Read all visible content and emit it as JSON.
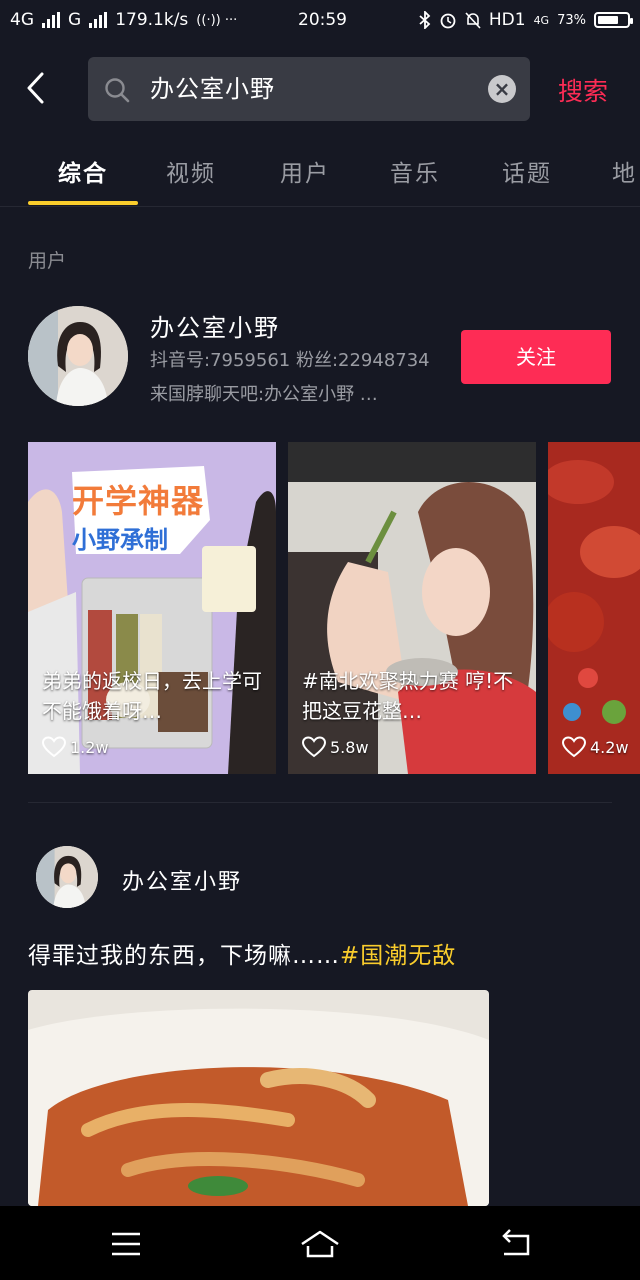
{
  "status_bar": {
    "net1": "4G",
    "net2": "G",
    "speed": "179.1k/s",
    "extra": "((·)) ···",
    "time": "20:59",
    "hd": "HD1",
    "net3": "4G",
    "battery": "73%",
    "battery_level": 0.73
  },
  "search": {
    "query": "办公室小野",
    "clear_label": "×",
    "submit_label": "搜索"
  },
  "tabs": [
    "综合",
    "视频",
    "用户",
    "音乐",
    "话题",
    "地"
  ],
  "active_tab": 0,
  "users_section": {
    "label": "用户",
    "user": {
      "name": "办公室小野",
      "info": "抖音号:7959561 粉丝:22948734",
      "desc": "来国脖聊天吧:办公室小野 …",
      "follow_label": "关注"
    }
  },
  "videos": [
    {
      "overlay_title_1": "开学神器",
      "overlay_title_2": "小野承制",
      "caption": "弟弟的返校日，去上学可不能饿着呀…",
      "likes": "1.2w"
    },
    {
      "caption": "#南北欢聚热力赛 哼!不把这豆花整…",
      "likes": "5.8w"
    },
    {
      "caption": "",
      "likes": "4.2w"
    }
  ],
  "post": {
    "author": "办公室小野",
    "text": "得罪过我的东西，下场嘛……",
    "tag": "#国潮无敌"
  },
  "colors": {
    "background": "#161823",
    "accent_red": "#fe2c55",
    "accent_yellow": "#facd2c"
  },
  "icons": {
    "back": "chevron-left-icon",
    "search": "search-icon",
    "like": "heart-outline-icon",
    "nav_menu": "menu-icon",
    "nav_home": "home-icon",
    "nav_back": "back-icon"
  }
}
